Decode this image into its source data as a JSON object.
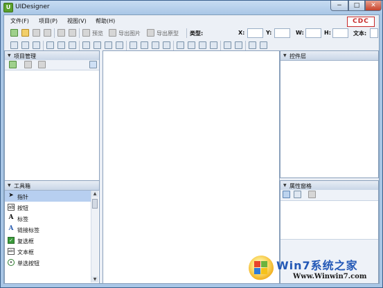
{
  "window": {
    "title": "UIDesigner",
    "minimize": "−",
    "maximize": "□",
    "close": "✕"
  },
  "menu": [
    "文件(F)",
    "项目(P)",
    "视图(V)",
    "帮助(H)"
  ],
  "logo": "CDC",
  "toolbar": {
    "preview": "预览",
    "export_image": "导出图片",
    "export_prototype": "导出原型",
    "type_label": "类型:",
    "x_label": "X:",
    "y_label": "Y:",
    "w_label": "W:",
    "h_label": "H:",
    "text_label": "文本:"
  },
  "panels": {
    "project": {
      "title": "项目管理",
      "collapse_icon": "▼"
    },
    "controls": {
      "title": "控件层",
      "collapse_icon": "▼"
    },
    "toolbox": {
      "title": "工具箱",
      "collapse_icon": "▼"
    },
    "properties": {
      "title": "属性窗格",
      "collapse_icon": "▼"
    }
  },
  "toolbox_items": [
    {
      "icon": "pointer-icon",
      "glyph": "➤",
      "label": "指针",
      "selected": true
    },
    {
      "icon": "button-icon",
      "glyph": "ab",
      "label": "按钮",
      "selected": false
    },
    {
      "icon": "label-icon",
      "glyph": "A",
      "label": "标签",
      "selected": false
    },
    {
      "icon": "link-label-icon",
      "glyph": "A",
      "label": "链接标签",
      "selected": false
    },
    {
      "icon": "checkbox-icon",
      "glyph": "✓",
      "label": "复选框",
      "selected": false
    },
    {
      "icon": "textbox-icon",
      "glyph": "abl",
      "label": "文本框",
      "selected": false
    },
    {
      "icon": "radio-icon",
      "glyph": "•",
      "label": "单选按钮",
      "selected": false
    }
  ],
  "watermark": {
    "title": "Win7系统之家",
    "url": "Www.Winwin7.com"
  },
  "colors": {
    "accent_selected": "#b7cff0",
    "logo_red": "#c62828",
    "frame": "#a9c6e6"
  }
}
